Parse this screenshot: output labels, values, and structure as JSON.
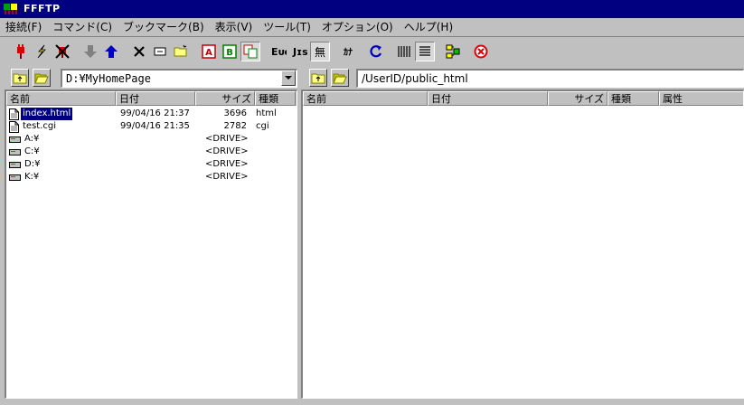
{
  "window": {
    "title": "FFFTP"
  },
  "menu": [
    "接続(F)",
    "コマンド(C)",
    "ブックマーク(B)",
    "表示(V)",
    "ツール(T)",
    "オプション(O)",
    "ヘルプ(H)"
  ],
  "toolbar": {
    "buttons": [
      "connect-icon",
      "quick-connect-icon",
      "disconnect-icon",
      "download-icon",
      "upload-icon",
      "delete-icon",
      "rename-icon",
      "new-folder-icon",
      "ascii-mode-icon",
      "binary-mode-icon",
      "auto-mode-icon",
      "euc-kanji-icon",
      "jis-kanji-icon",
      "no-kanji-conversion-icon",
      "hankaku-kana-icon",
      "refresh-icon",
      "list-view-icon",
      "detail-view-icon",
      "sync-folder-icon",
      "abort-icon"
    ],
    "labels": {
      "ascii": "A",
      "binary": "B",
      "euc": "Eᴜᴄ",
      "jis": "Jɪs",
      "no_conv": "無",
      "kana": "ｶﾅ"
    }
  },
  "local": {
    "path": "D:¥MyHomePage",
    "columns": [
      "名前",
      "日付",
      "サイズ",
      "種類"
    ],
    "files": [
      {
        "name": "index.html",
        "date": "99/04/16 21:37",
        "size": "3696",
        "type": "html",
        "kind": "file",
        "selected": true
      },
      {
        "name": "test.cgi",
        "date": "99/04/16 21:35",
        "size": "2782",
        "type": "cgi",
        "kind": "file",
        "selected": false
      },
      {
        "name": "A:¥",
        "date": "",
        "size": "<DRIVE>",
        "type": "",
        "kind": "drive",
        "selected": false
      },
      {
        "name": "C:¥",
        "date": "",
        "size": "<DRIVE>",
        "type": "",
        "kind": "drive",
        "selected": false
      },
      {
        "name": "D:¥",
        "date": "",
        "size": "<DRIVE>",
        "type": "",
        "kind": "drive",
        "selected": false
      },
      {
        "name": "K:¥",
        "date": "",
        "size": "<DRIVE>",
        "type": "",
        "kind": "drive",
        "selected": false
      }
    ]
  },
  "remote": {
    "path": "/UserID/public_html",
    "columns": [
      "名前",
      "日付",
      "サイズ",
      "種類",
      "属性"
    ],
    "files": []
  }
}
